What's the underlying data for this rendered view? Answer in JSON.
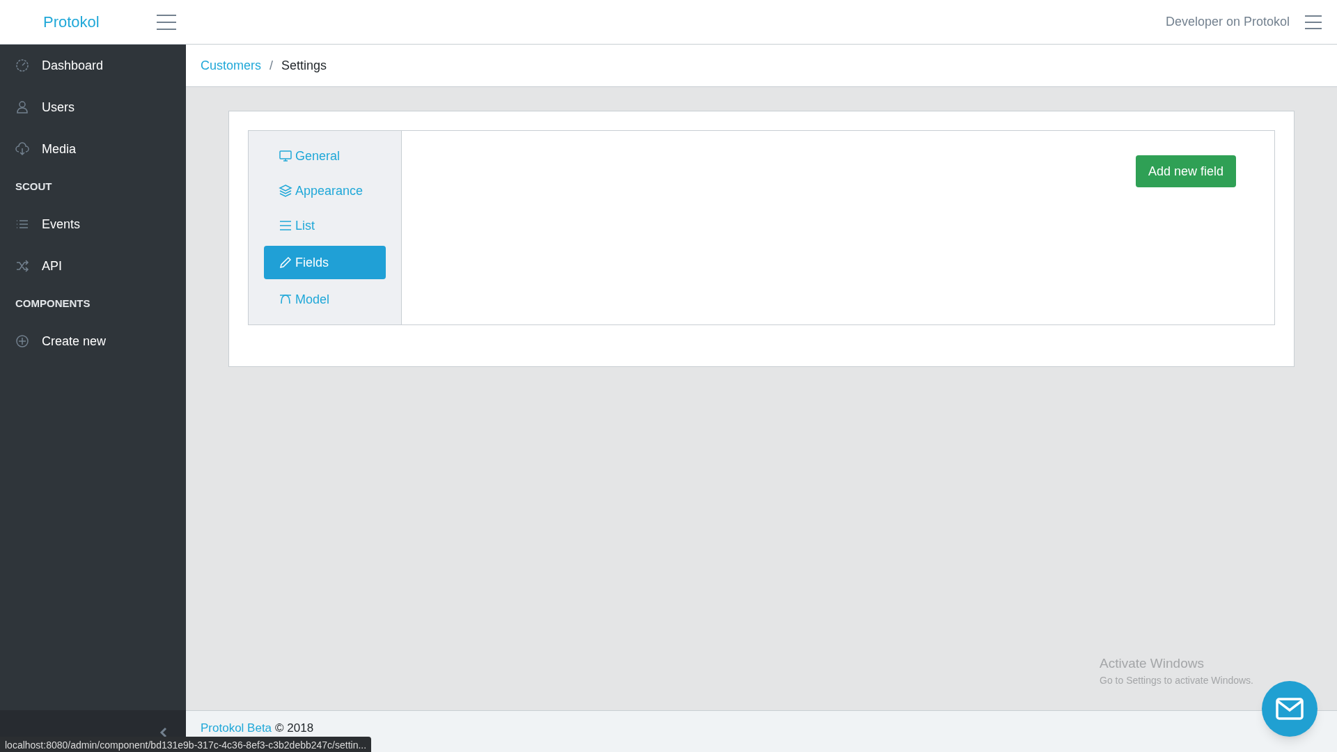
{
  "header": {
    "brand": "Protokol",
    "user": "Developer on Protokol"
  },
  "sidebar": {
    "sections": [
      {
        "items": [
          {
            "label": "Dashboard"
          },
          {
            "label": "Users"
          },
          {
            "label": "Media"
          }
        ]
      },
      {
        "title": "SCOUT",
        "items": [
          {
            "label": "Events"
          },
          {
            "label": "API"
          }
        ]
      },
      {
        "title": "COMPONENTS",
        "items": [
          {
            "label": "Create new"
          }
        ]
      }
    ]
  },
  "breadcrumb_separator": "/",
  "breadcrumb": [
    {
      "label": "Customers",
      "kind": "link"
    },
    {
      "label": "Settings",
      "kind": "current"
    }
  ],
  "tabs": [
    {
      "label": "General",
      "selected": false
    },
    {
      "label": "Appearance",
      "selected": false
    },
    {
      "label": "List",
      "selected": false
    },
    {
      "label": "Fields",
      "selected": true
    },
    {
      "label": "Model",
      "selected": false
    }
  ],
  "add_button": "Add new field",
  "footer": {
    "link": "Protokol Beta",
    "text": "© 2018"
  },
  "activation_notice": {
    "title": "Activate Windows",
    "subtitle": "Go to Settings to activate Windows."
  },
  "status_url": "localhost:8080/admin/component/bd131e9b-317c-4c36-8ef3-c3b2debb247c/settin..."
}
